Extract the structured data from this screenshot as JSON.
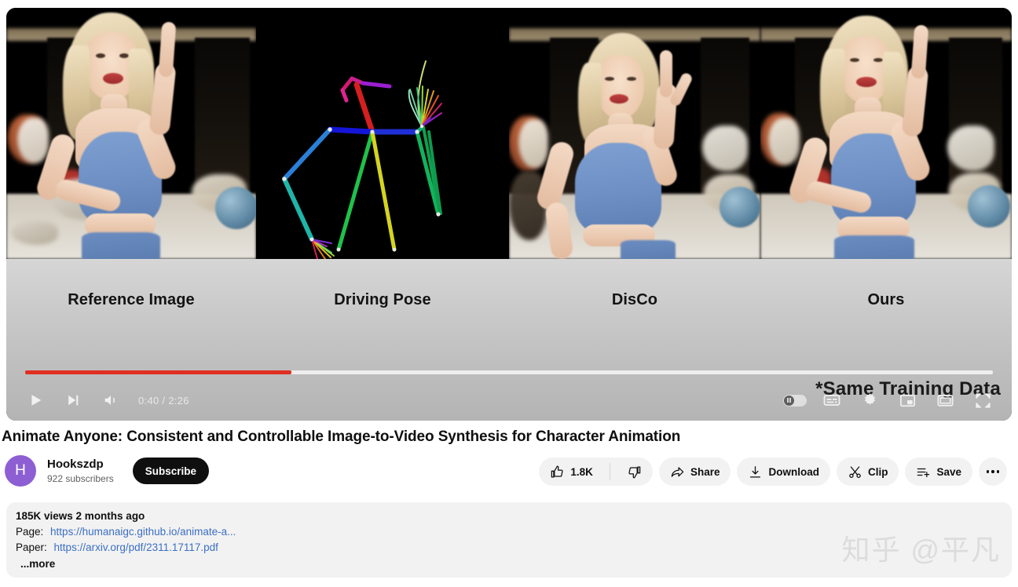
{
  "player": {
    "panels": [
      {
        "label": "Reference Image",
        "kind": "photo"
      },
      {
        "label": "Driving Pose",
        "kind": "skeleton"
      },
      {
        "label": "DisCo",
        "kind": "photo"
      },
      {
        "label": "Ours",
        "kind": "photo"
      }
    ],
    "overlay_text": "*Same Training Data",
    "time_display": "0:40 / 2:26",
    "current_time": "0:40",
    "duration": "2:26",
    "progress_percent": 27.5,
    "progress_color": "#e02f21",
    "controls": {
      "play": "Play",
      "next": "Next",
      "volume": "Mute",
      "autoplay": "Autoplay is on",
      "subtitles": "Subtitles/closed captions",
      "settings": "Settings",
      "miniplayer": "Miniplayer",
      "theater": "Theater mode",
      "fullscreen": "Full screen"
    }
  },
  "meta": {
    "title": "Animate Anyone: Consistent and Controllable Image-to-Video Synthesis for Character Animation",
    "channel": {
      "avatar_letter": "H",
      "avatar_color": "#8d5fd3",
      "name": "Hookszdp",
      "subscribers": "922 subscribers",
      "subscribe_label": "Subscribe"
    },
    "actions": {
      "like_count": "1.8K",
      "dislike_label": "",
      "share_label": "Share",
      "download_label": "Download",
      "clip_label": "Clip",
      "save_label": "Save",
      "more_label": "More actions"
    }
  },
  "description": {
    "views": "185K views",
    "published": "2 months ago",
    "stats_line": "185K views  2 months ago",
    "links": [
      {
        "prefix": "Page:",
        "url": "https://humanaigc.github.io/animate-a..."
      },
      {
        "prefix": "Paper:",
        "url": "https://arxiv.org/pdf/2311.17117.pdf"
      }
    ],
    "more_label": "...more"
  },
  "watermark": {
    "text": "知乎 @平凡"
  }
}
